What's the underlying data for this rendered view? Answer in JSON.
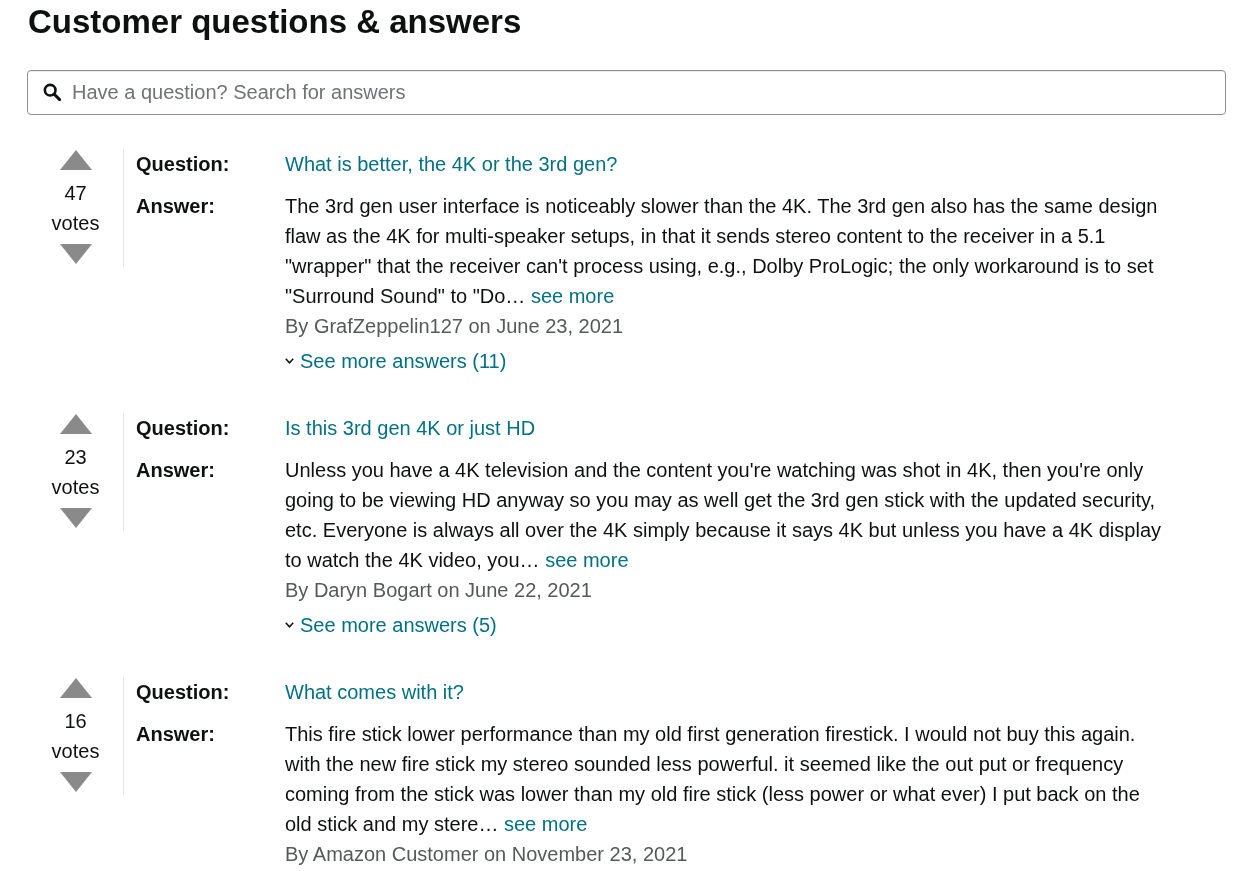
{
  "heading": "Customer questions & answers",
  "search": {
    "placeholder": "Have a question? Search for answers"
  },
  "questions": [
    {
      "votes": {
        "count": "47",
        "label": "votes"
      },
      "question_label": "Question:",
      "question": "What is better, the 4K or the 3rd gen?",
      "answer_label": "Answer:",
      "answer": "The 3rd gen user interface is noticeably slower than the 4K. The 3rd gen also has the same design\nflaw as the 4K for multi-speaker setups, in that it sends stereo content to the receiver in a 5.1\n\"wrapper\" that the receiver can't process using, e.g., Dolby ProLogic; the only workaround is to set\n\"Surround Sound\" to \"Do…",
      "see_more": "see more",
      "byline": "By GrafZeppelin127 on June 23, 2021",
      "more_answers": "See more answers (11)"
    },
    {
      "votes": {
        "count": "23",
        "label": "votes"
      },
      "question_label": "Question:",
      "question": "Is this 3rd gen 4K or just HD",
      "answer_label": "Answer:",
      "answer": "Unless you have a 4K television and the content you're watching was shot in 4K, then you're only\ngoing to be viewing HD anyway so you may as well get the 3rd gen stick with the updated security,\netc. Everyone is always all over the 4K simply because it says 4K but unless you have a 4K display\nto watch the 4K video, you…",
      "see_more": "see more",
      "byline": "By Daryn Bogart on June 22, 2021",
      "more_answers": "See more answers (5)"
    },
    {
      "votes": {
        "count": "16",
        "label": "votes"
      },
      "question_label": "Question:",
      "question": "What comes with it?",
      "answer_label": "Answer:",
      "answer": "This fire stick lower performance than my old first generation firestick. I would not buy this again.\nwith the new fire stick my stereo sounded less powerful. it seemed like the out put or frequency\ncoming from the stick was lower than my old fire stick (less power or what ever) I put back on the\nold stick and my stere…",
      "see_more": "see more",
      "byline": "By Amazon Customer on November 23, 2021"
    }
  ]
}
